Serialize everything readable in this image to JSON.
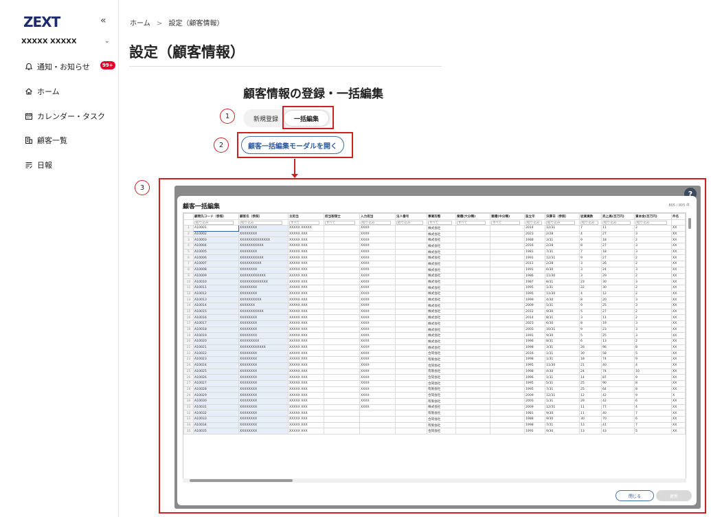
{
  "sidebar": {
    "logo": "ZEXT",
    "collapse_icon": "«",
    "user_name": "XXXXX XXXXX",
    "user_chevron": "⌄",
    "badge": "99+",
    "items": [
      {
        "icon": "bell-icon",
        "label": "通知・お知らせ"
      },
      {
        "icon": "home-icon",
        "label": "ホーム"
      },
      {
        "icon": "calendar-icon",
        "label": "カレンダー・タスク"
      },
      {
        "icon": "building-icon",
        "label": "顧客一覧"
      },
      {
        "icon": "report-icon",
        "label": "日報"
      }
    ]
  },
  "header": {
    "breadcrumb_home": "ホーム",
    "breadcrumb_sep": ">",
    "breadcrumb_current": "設定（顧客情報）",
    "page_title": "設定（顧客情報）"
  },
  "main": {
    "section_title": "顧客情報の登録・一括編集",
    "tab_new": "新規登録",
    "tab_bulk": "一括編集",
    "open_modal_label": "顧客一括編集モーダルを開く",
    "callouts": [
      "1",
      "2",
      "3"
    ]
  },
  "modal": {
    "title": "顧客一括編集",
    "count": "805 / 805 件",
    "help": "?",
    "close_label": "閉じる",
    "save_label": "更新",
    "columns": [
      "顧問先コード（参照）",
      "顧客名（参照）",
      "主担当",
      "担当税理士",
      "入力担当",
      "法人番号",
      "事業形態",
      "業種(大分類)",
      "業種(中分類)",
      "設立年",
      "決算日（参照）",
      "従業員数",
      "売上高(百万円)",
      "資本金(百万円)",
      "件名"
    ],
    "filters": [
      "絞り込み",
      "絞り込み",
      "すべて",
      "すべて",
      "絞り込み",
      "絞り込み",
      "すべて",
      "すべて",
      "すべて",
      "絞り込み",
      "絞り込み",
      "絞り込み",
      "絞り込み",
      "絞り込み",
      ""
    ],
    "rows": [
      [
        "1",
        "A10001",
        "XXXXXXXX",
        "XXXXX XXXXX",
        "",
        "XXXX",
        "",
        "株式会社",
        "",
        "",
        "2014",
        "12/31",
        "7",
        "11",
        "2",
        "XX"
      ],
      [
        "2",
        "A10002",
        "XXXXXXXX",
        "XXXXX XXX",
        "",
        "XXXX",
        "",
        "株式会社",
        "",
        "",
        "2023",
        "2/28",
        "4",
        "27",
        "3",
        "XX"
      ],
      [
        "3",
        "A10003",
        "XXXXXXXXXXXXXX",
        "XXXXX XXX",
        "",
        "XXXX",
        "",
        "株式会社",
        "",
        "",
        "1988",
        "3/31",
        "9",
        "18",
        "2",
        "XX"
      ],
      [
        "4",
        "A10004",
        "XXXXXXXXXXX",
        "XXXXX XXX",
        "",
        "XXXX",
        "",
        "株式会社",
        "",
        "",
        "2016",
        "2/28",
        "8",
        "27",
        "3",
        "XX"
      ],
      [
        "5",
        "A10005",
        "XXXXXXXX",
        "XXXXX XXX",
        "",
        "XXXX",
        "",
        "株式会社",
        "",
        "",
        "1981",
        "7/31",
        "7",
        "18",
        "3",
        "XX"
      ],
      [
        "6",
        "A10006",
        "XXXXXXXXXXX",
        "XXXXX XXX",
        "",
        "XXXX",
        "",
        "株式会社",
        "",
        "",
        "1991",
        "12/31",
        "9",
        "27",
        "2",
        "XX"
      ],
      [
        "7",
        "A10007",
        "XXXXXXXXXX",
        "XXXXX XXX",
        "",
        "XXXX",
        "",
        "株式会社",
        "",
        "",
        "2011",
        "2/28",
        "3",
        "26",
        "2",
        "XX"
      ],
      [
        "8",
        "A10008",
        "XXXXXXXX",
        "XXXXX XXX",
        "",
        "XXXX",
        "",
        "株式会社",
        "",
        "",
        "1991",
        "6/30",
        "3",
        "24",
        "3",
        "XX"
      ],
      [
        "9",
        "A10009",
        "XXXXXXXXXXXX",
        "XXXXX XXX",
        "",
        "XXXX",
        "",
        "株式会社",
        "",
        "",
        "1986",
        "11/30",
        "3",
        "29",
        "2",
        "XX"
      ],
      [
        "10",
        "A10010",
        "XXXXXXXXXXXXX",
        "XXXXX XXX",
        "",
        "XXXX",
        "",
        "株式会社",
        "",
        "",
        "1987",
        "8/31",
        "23",
        "30",
        "3",
        "XX"
      ],
      [
        "11",
        "A10011",
        "XXXXXXXX",
        "XXXXX XXX",
        "",
        "XXXX",
        "",
        "株式会社",
        "",
        "",
        "1995",
        "1/31",
        "22",
        "30",
        "2",
        "XX"
      ],
      [
        "12",
        "A10012",
        "XXXXXXXX",
        "XXXXX XXX",
        "",
        "XXXX",
        "",
        "株式会社",
        "",
        "",
        "1995",
        "11/30",
        "4",
        "12",
        "2",
        "XX"
      ],
      [
        "13",
        "A10013",
        "XXXXXXXXXX",
        "XXXXX XXX",
        "",
        "XXXX",
        "",
        "株式会社",
        "",
        "",
        "1999",
        "4/30",
        "8",
        "20",
        "3",
        "XX"
      ],
      [
        "14",
        "A10014",
        "XXXXXXX",
        "XXXXX XXX",
        "",
        "XXXX",
        "",
        "株式会社",
        "",
        "",
        "2009",
        "5/31",
        "9",
        "25",
        "3",
        "XX"
      ],
      [
        "15",
        "A10015",
        "XXXXXXXXXXX",
        "XXXXX XXX",
        "",
        "XXXX",
        "",
        "株式会社",
        "",
        "",
        "2012",
        "9/30",
        "5",
        "27",
        "2",
        "XX"
      ],
      [
        "16",
        "A10016",
        "XXXXXXXX",
        "XXXXX XXX",
        "",
        "XXXX",
        "",
        "株式会社",
        "",
        "",
        "2014",
        "8/31",
        "3",
        "11",
        "2",
        "XX"
      ],
      [
        "17",
        "A10017",
        "XXXXXXXX",
        "XXXXX XXX",
        "",
        "XXXX",
        "",
        "株式会社",
        "",
        "",
        "2023",
        "6/30",
        "8",
        "19",
        "3",
        "XX"
      ],
      [
        "18",
        "A10018",
        "XXXXXXXX",
        "XXXXX XXX",
        "",
        "XXXX",
        "",
        "株式会社",
        "",
        "",
        "2003",
        "10/31",
        "9",
        "23",
        "3",
        "XX"
      ],
      [
        "19",
        "A10019",
        "XXXXXXXX",
        "XXXXX XXX",
        "",
        "XXXX",
        "",
        "株式会社",
        "",
        "",
        "1991",
        "9/30",
        "5",
        "25",
        "3",
        "XX"
      ],
      [
        "20",
        "A10020",
        "XXXXXXXXX",
        "XXXXX XXX",
        "",
        "XXXX",
        "",
        "株式会社",
        "",
        "",
        "1996",
        "8/31",
        "6",
        "13",
        "2",
        "XX"
      ],
      [
        "21",
        "A10021",
        "XXXXXXXXXXXX",
        "XXXXX XXX",
        "",
        "XXXX",
        "",
        "株式会社",
        "",
        "",
        "1998",
        "3/31",
        "26",
        "96",
        "8",
        "XX"
      ],
      [
        "22",
        "A10022",
        "XXXXXXXX",
        "XXXXX XXX",
        "",
        "XXXX",
        "",
        "合同会社",
        "",
        "",
        "2016",
        "1/31",
        "30",
        "58",
        "5",
        "XX"
      ],
      [
        "23",
        "A10023",
        "XXXXXXXX",
        "XXXXX XXX",
        "",
        "XXXX",
        "",
        "有限会社",
        "",
        "",
        "1998",
        "1/31",
        "18",
        "74",
        "9",
        "XX"
      ],
      [
        "24",
        "A10024",
        "XXXXXXXX",
        "XXXXX XXX",
        "",
        "XXXX",
        "",
        "合同会社",
        "",
        "",
        "1995",
        "11/30",
        "21",
        "40",
        "4",
        "XX"
      ],
      [
        "25",
        "A10025",
        "XXXXXXXX",
        "XXXXX XXX",
        "",
        "XXXX",
        "",
        "有限会社",
        "",
        "",
        "1998",
        "4/30",
        "24",
        "74",
        "10",
        "XX"
      ],
      [
        "26",
        "A10026",
        "XXXXXXXX",
        "XXXXX XXX",
        "",
        "XXXX",
        "",
        "合同会社",
        "",
        "",
        "1996",
        "1/31",
        "14",
        "87",
        "9",
        "XX"
      ],
      [
        "27",
        "A10027",
        "XXXXXXXX",
        "XXXXX XXX",
        "",
        "XXXX",
        "",
        "合同会社",
        "",
        "",
        "1995",
        "5/31",
        "25",
        "90",
        "8",
        "XX"
      ],
      [
        "28",
        "A10028",
        "XXXXXXXX",
        "XXXXX XXX",
        "",
        "XXXX",
        "",
        "有限会社",
        "",
        "",
        "1995",
        "7/31",
        "25",
        "64",
        "8",
        "XX"
      ],
      [
        "29",
        "A10029",
        "XXXXXXXX",
        "XXXXX XXX",
        "",
        "XXXX",
        "",
        "合同会社",
        "",
        "",
        "2009",
        "12/31",
        "12",
        "42",
        "9",
        "X"
      ],
      [
        "30",
        "A10030",
        "XXXXXXXX",
        "XXXXX XXX",
        "",
        "XXXX",
        "",
        "有限会社",
        "",
        "",
        "2003",
        "1/31",
        "29",
        "42",
        "6",
        "XX"
      ],
      [
        "31",
        "A10031",
        "XXXXXXXX",
        "XXXXX XXX",
        "",
        "XXXX",
        "",
        "株式会社",
        "",
        "",
        "2009",
        "12/31",
        "11",
        "77",
        "4",
        "XX"
      ],
      [
        "32",
        "A10032",
        "XXXXXXXX",
        "XXXXX XXX",
        "",
        "",
        "",
        "有限会社",
        "",
        "",
        "1981",
        "9/30",
        "11",
        "40",
        "7",
        "XX"
      ],
      [
        "33",
        "A10033",
        "XXXXXXXX",
        "XXXXX XXX",
        "",
        "",
        "",
        "合同会社",
        "",
        "",
        "1988",
        "9/30",
        "30",
        "70",
        "6",
        "XX"
      ],
      [
        "34",
        "A10034",
        "XXXXXXXX",
        "XXXXX XXX",
        "",
        "",
        "",
        "有限会社",
        "",
        "",
        "1998",
        "7/31",
        "13",
        "41",
        "7",
        "XX"
      ],
      [
        "35",
        "A10035",
        "XXXXXXXX",
        "XXXXX XXX",
        "",
        "",
        "",
        "合同会社",
        "",
        "",
        "1991",
        "9/30",
        "13",
        "43",
        "5",
        "XX"
      ]
    ]
  }
}
